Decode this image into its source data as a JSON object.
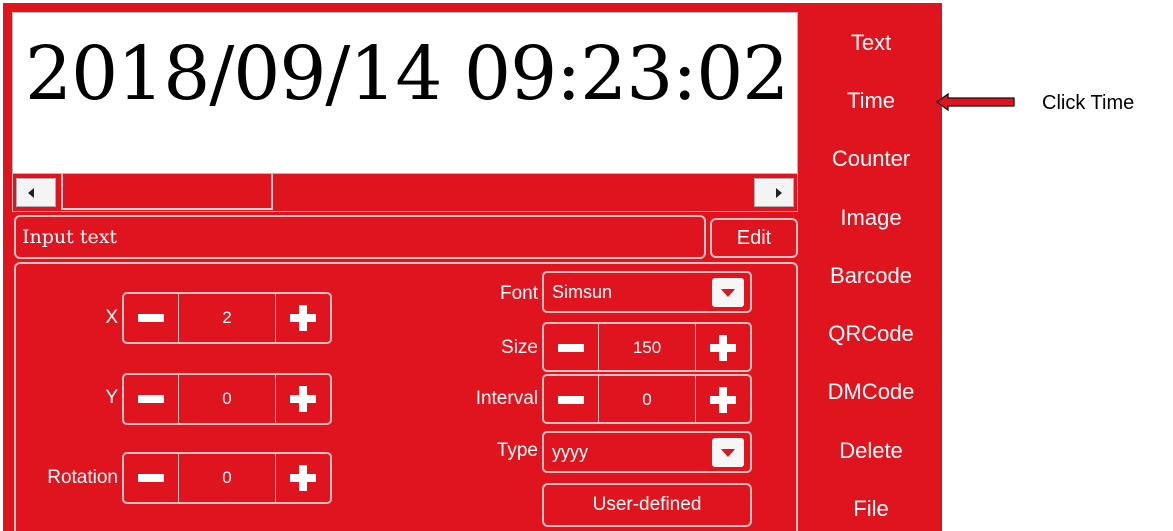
{
  "preview": {
    "text": "2018/09/14 09:23:02"
  },
  "input": {
    "label": "Input text",
    "edit_label": "Edit"
  },
  "controls": {
    "x": {
      "label": "X",
      "value": "2"
    },
    "y": {
      "label": "Y",
      "value": "0"
    },
    "rotation": {
      "label": "Rotation",
      "value": "0"
    },
    "font": {
      "label": "Font",
      "value": "Simsun"
    },
    "size": {
      "label": "Size",
      "value": "150"
    },
    "interval": {
      "label": "Interval",
      "value": "0"
    },
    "type": {
      "label": "Type",
      "value": "yyyy"
    },
    "user_defined_label": "User-defined"
  },
  "menu": {
    "items": [
      {
        "label": "Text"
      },
      {
        "label": "Time"
      },
      {
        "label": "Counter"
      },
      {
        "label": "Image"
      },
      {
        "label": "Barcode"
      },
      {
        "label": "QRCode"
      },
      {
        "label": "DMCode"
      },
      {
        "label": "Delete"
      },
      {
        "label": "File"
      }
    ]
  },
  "annotation": {
    "text": "Click Time"
  },
  "colors": {
    "panel": "#e0141e",
    "annotation_arrow": "#e0141e"
  },
  "icons": [
    "scroll-left-icon",
    "scroll-right-icon",
    "minus-icon",
    "plus-icon",
    "dropdown-caret-icon",
    "left-arrow-icon"
  ]
}
